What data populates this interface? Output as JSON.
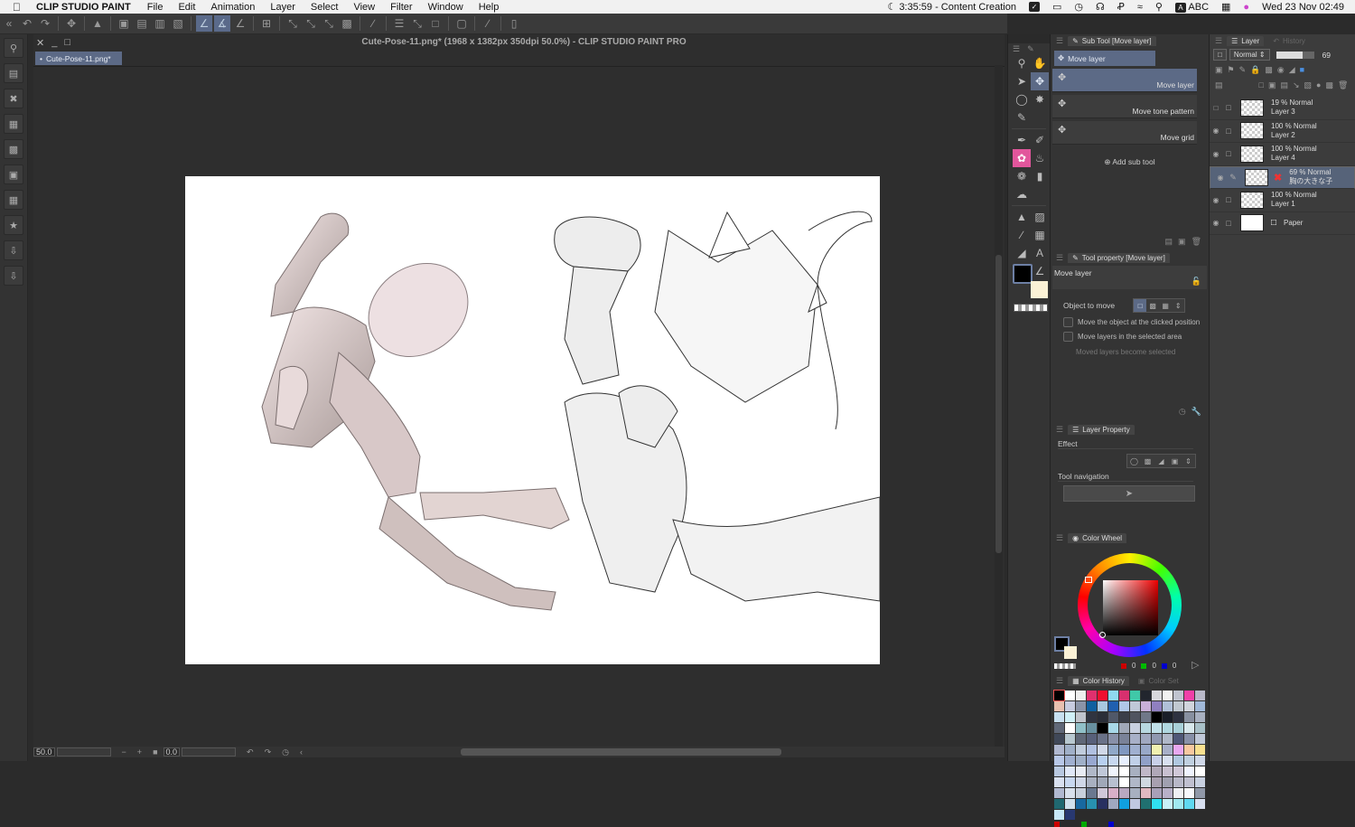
{
  "menubar": {
    "app_name": "CLIP STUDIO PAINT",
    "items": [
      "File",
      "Edit",
      "Animation",
      "Layer",
      "Select",
      "View",
      "Filter",
      "Window",
      "Help"
    ],
    "status": "3:35:59 - Content Creation",
    "input_source": "ABC",
    "datetime": "Wed 23 Nov  02:49"
  },
  "document": {
    "window_title": "Cute-Pose-11.png* (1968 x 1382px 350dpi 50.0%)  - CLIP STUDIO PAINT PRO",
    "tab_label": "Cute-Pose-11.png*"
  },
  "statusbar": {
    "zoom": "50.0",
    "rotation": "0.0"
  },
  "subtool_panel": {
    "title": "Sub Tool [Move layer]",
    "group_label": "Move layer",
    "items": [
      {
        "label": "Move layer",
        "selected": true
      },
      {
        "label": "Move tone pattern",
        "selected": false
      },
      {
        "label": "Move grid",
        "selected": false
      }
    ],
    "add_label": "Add sub tool"
  },
  "tool_property": {
    "title": "Tool property [Move layer]",
    "tool_name": "Move layer",
    "object_to_move_label": "Object to move",
    "options": [
      {
        "label": "Move the object at the clicked position",
        "checked": false
      },
      {
        "label": "Move layers in the selected area",
        "checked": false
      }
    ],
    "note": "Moved layers become selected"
  },
  "layer_property": {
    "title": "Layer Property",
    "effect_label": "Effect",
    "tool_nav_label": "Tool navigation"
  },
  "color_wheel": {
    "title": "Color Wheel",
    "main_color": "#000000",
    "sub_color": "#fbf2d6",
    "r": "0",
    "g": "0",
    "b": "0"
  },
  "color_history": {
    "tab_history": "Color History",
    "tab_set": "Color Set",
    "swatches": [
      "#000000",
      "#ffffff",
      "#eeeeee",
      "#e0306e",
      "#f01030",
      "#8fd8f0",
      "#d8306e",
      "#40c8a8",
      "#22262e",
      "#d8d8dc",
      "#f2f2f2",
      "#c0c4d0",
      "#f040a8",
      "#b8b8c8",
      "#e8c0b0",
      "#c8cce0",
      "#8a94a8",
      "#1060a0",
      "#a8c8e0",
      "#2060b0",
      "#b0c8e8",
      "#c0c8d8",
      "#c8b0d8",
      "#9080c0",
      "#b0c0d8",
      "#c0c8d0",
      "#d0d4dc",
      "#a0b8d8",
      "#c8e0f0",
      "#d0f0f8",
      "#c0c4cc",
      "#303440",
      "#2a2e38",
      "#505868",
      "#3a3e48",
      "#505460",
      "#707888",
      "#000000",
      "#1a1e28",
      "#2e3240",
      "#8890a0",
      "#a8b0c0",
      "#606878",
      "#ffffff",
      "#90c0c8",
      "#6890a0",
      "#000000",
      "#a8d8e8",
      "#a0a8b8",
      "#c8d0e0",
      "#b8d8e0",
      "#c0e0e8",
      "#b0d8e0",
      "#a8d0d8",
      "#d8e8ec",
      "#a8c0c8",
      "#404858",
      "#b8c8d0",
      "#606878",
      "#58607a",
      "#6a7288",
      "#8890a8",
      "#7a8298",
      "#a8b0c8",
      "#a0a8c0",
      "#9098b0",
      "#b0b8c8",
      "#505878",
      "#8890a8",
      "#c0c8d8",
      "#b0b8d0",
      "#a0b0c8",
      "#c0ccdc",
      "#b0c0e0",
      "#d0d8e8",
      "#90a8c8",
      "#8098c0",
      "#a0b0d0",
      "#98a8c8",
      "#f0f0b0",
      "#a8b0c8",
      "#e8a8f0",
      "#f8c8a0",
      "#f8e090",
      "#b8c8e8",
      "#a0b0d0",
      "#a0b0c8",
      "#98a8d0",
      "#b8d0f0",
      "#c8d8f0",
      "#e8f0ff",
      "#c0d0e8",
      "#90a0c8",
      "#c8d0e8",
      "#d8e0f0",
      "#b0c8e0",
      "#c0d0e0",
      "#d0d8e8",
      "#b8c8e0",
      "#e0e8f8",
      "#e8ecf4",
      "#b0b8c8",
      "#c0c8d8",
      "#f0f4fc",
      "#ffffff",
      "#a8b0c0",
      "#c0b8c8",
      "#b0a8b8",
      "#c8c0d0",
      "#d0c8d8",
      "#f0f4ff",
      "#ffffff",
      "#d8e0f0",
      "#c8d8f0",
      "#d0d8e8",
      "#a8b0c0",
      "#a0a8b8",
      "#b8c0d0",
      "#ffffff",
      "#b0b8c8",
      "#d0d8e0",
      "#a8a0b0",
      "#a0a0b0",
      "#b8b8c8",
      "#c0c0d0",
      "#c8d0e0",
      "#b0b8d0",
      "#d8e0ec",
      "#c8d0dc",
      "#6a7890",
      "#d0c8d8",
      "#d8b0c8",
      "#b8a8c0",
      "#a8b0c0",
      "#e0b8c0",
      "#a8a0b8",
      "#b8b0c8",
      "#f0f0f4",
      "#f8f8fc",
      "#9098a8",
      "#206870",
      "#d0e0ec",
      "#1868a0",
      "#2890b0",
      "#283060",
      "#a0a8c0",
      "#10a0e0",
      "#c0c8e0",
      "#207070",
      "#30e0f0",
      "#c8f0f8",
      "#a0e8f0",
      "#60d8f0",
      "#d8e0f0",
      "#c8e8f8",
      "#283870"
    ]
  },
  "layer_panel": {
    "tab_layer": "Layer",
    "tab_history": "History",
    "blend_mode": "Normal",
    "opacity": "69",
    "opacity_fraction": 0.69,
    "layers": [
      {
        "opacity_mode": "19 % Normal",
        "name": "Layer 3",
        "visible": false,
        "selected": false,
        "type": "raster"
      },
      {
        "opacity_mode": "100 % Normal",
        "name": "Layer 2",
        "visible": true,
        "selected": false,
        "type": "raster"
      },
      {
        "opacity_mode": "100 % Normal",
        "name": "Layer 4",
        "visible": true,
        "selected": false,
        "type": "raster"
      },
      {
        "opacity_mode": "69 % Normal",
        "name": "胸の大きな子",
        "visible": true,
        "selected": true,
        "type": "3d"
      },
      {
        "opacity_mode": "100 % Normal",
        "name": "Layer 1",
        "visible": true,
        "selected": false,
        "type": "raster"
      },
      {
        "opacity_mode": "",
        "name": "Paper",
        "visible": true,
        "selected": false,
        "type": "paper"
      }
    ]
  },
  "colors": {
    "accent": "#5c6a86",
    "panel_bg": "#343434",
    "canvas_bg": "#ffffff"
  }
}
